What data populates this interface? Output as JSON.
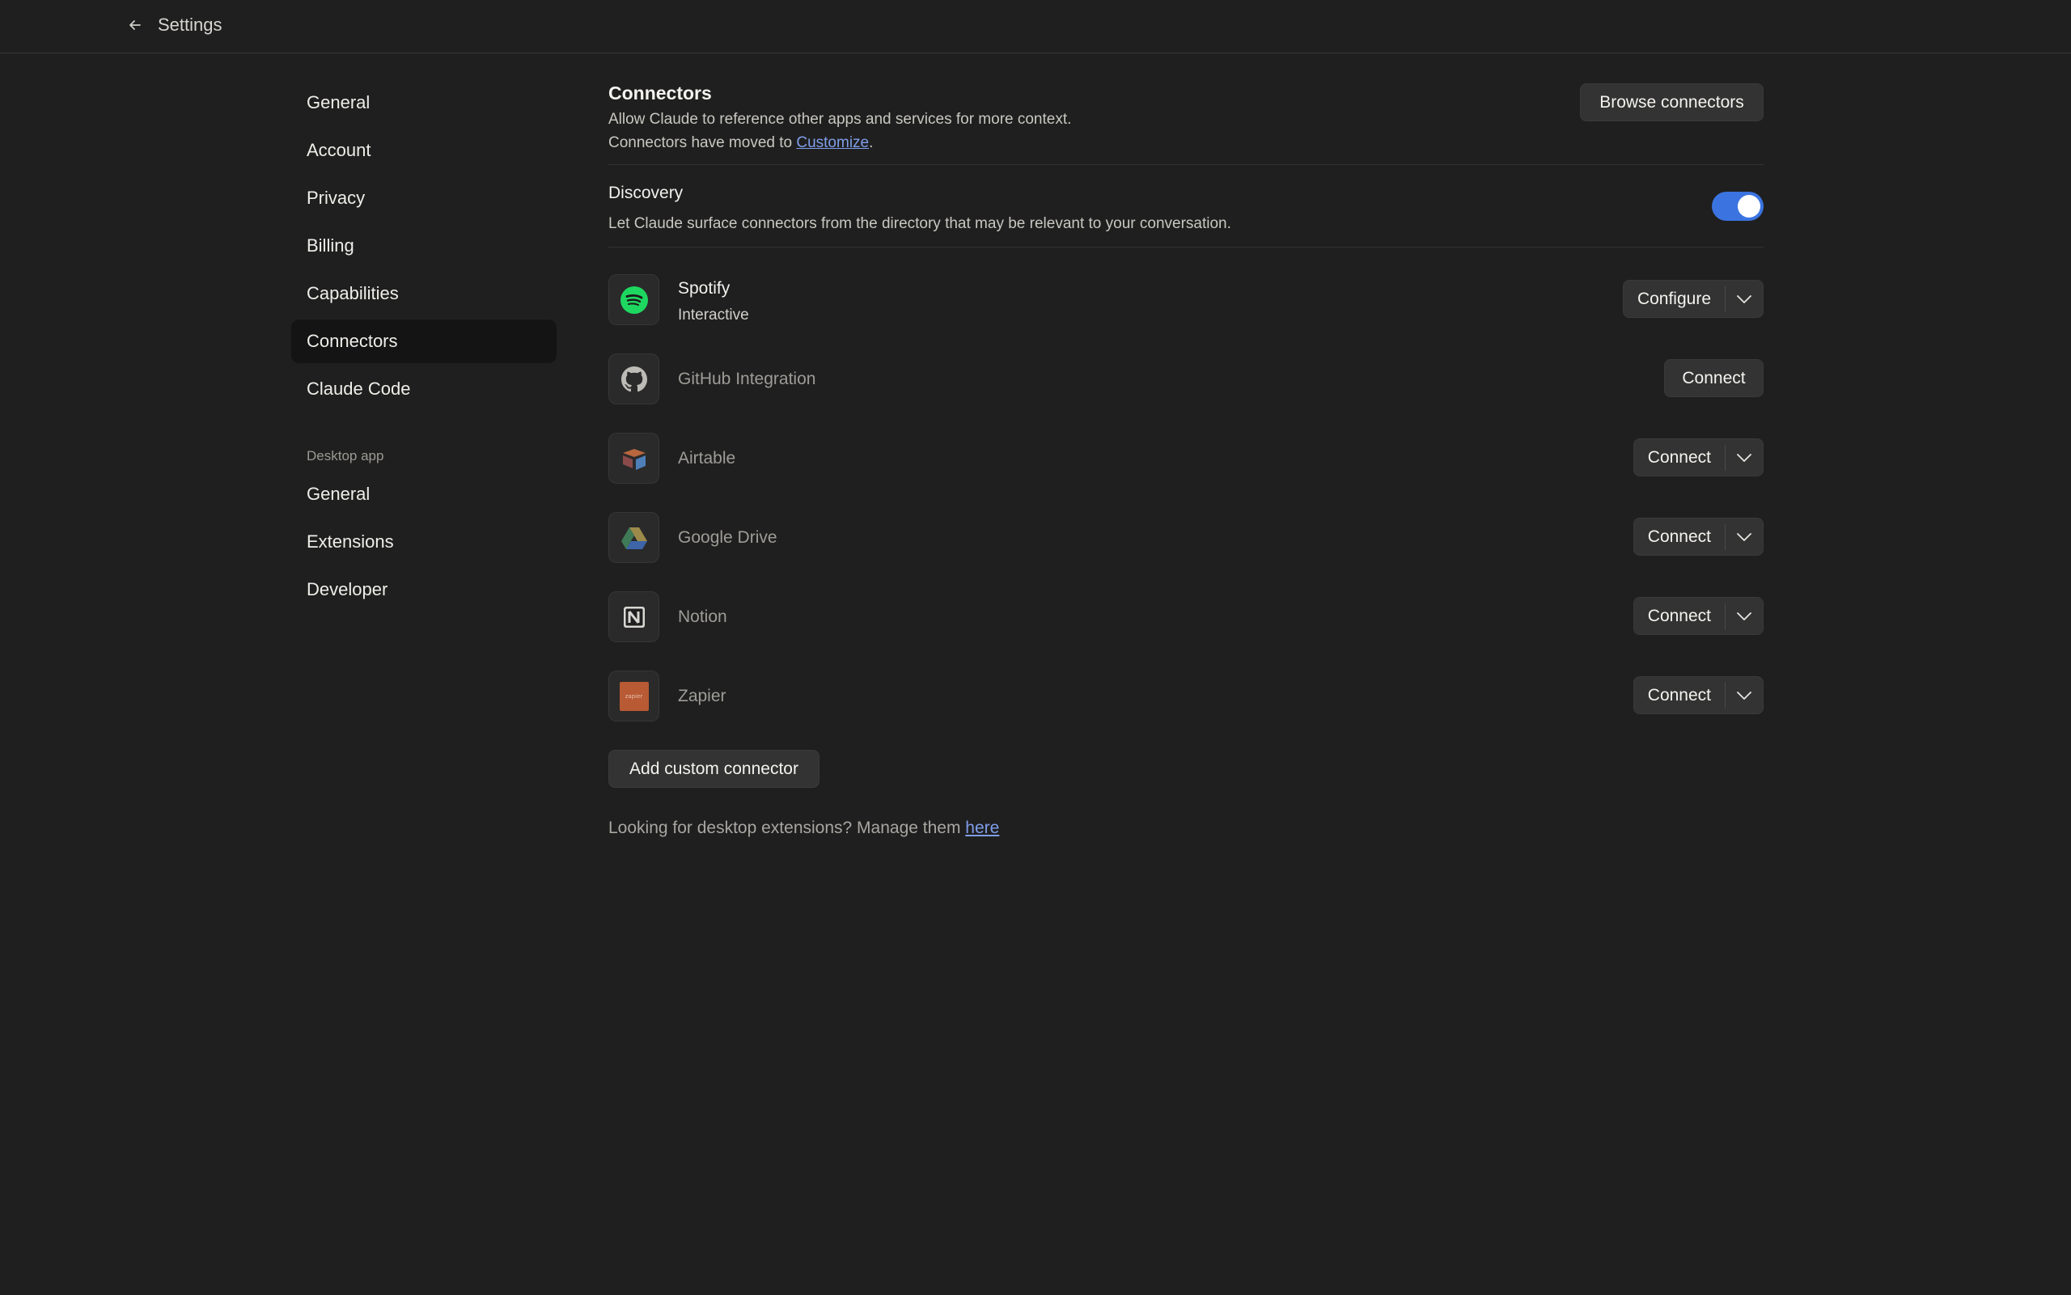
{
  "topbar": {
    "title": "Settings"
  },
  "sidebar": {
    "items": [
      {
        "label": "General"
      },
      {
        "label": "Account"
      },
      {
        "label": "Privacy"
      },
      {
        "label": "Billing"
      },
      {
        "label": "Capabilities"
      },
      {
        "label": "Connectors"
      },
      {
        "label": "Claude Code"
      }
    ],
    "section_label": "Desktop app",
    "desktop_items": [
      {
        "label": "General"
      },
      {
        "label": "Extensions"
      },
      {
        "label": "Developer"
      }
    ]
  },
  "header": {
    "title": "Connectors",
    "description": "Allow Claude to reference other apps and services for more context.",
    "moved_prefix": "Connectors have moved to ",
    "moved_link": "Customize",
    "moved_suffix": ".",
    "browse_label": "Browse connectors"
  },
  "discovery": {
    "title": "Discovery",
    "description": "Let Claude surface connectors from the directory that may be relevant to your conversation.",
    "enabled": true
  },
  "connectors": [
    {
      "name": "Spotify",
      "subtitle": "Interactive",
      "action": "Configure",
      "icon": "spotify-icon"
    },
    {
      "name": "GitHub Integration",
      "action": "Connect",
      "icon": "github-icon"
    },
    {
      "name": "Airtable",
      "action": "Connect",
      "icon": "airtable-icon"
    },
    {
      "name": "Google Drive",
      "action": "Connect",
      "icon": "google-drive-icon"
    },
    {
      "name": "Notion",
      "action": "Connect",
      "icon": "notion-icon"
    },
    {
      "name": "Zapier",
      "action": "Connect",
      "icon": "zapier-icon",
      "icon_text": "zapier"
    }
  ],
  "add_custom_label": "Add custom connector",
  "footer": {
    "prefix": "Looking for desktop extensions? Manage them ",
    "link": "here"
  },
  "colors": {
    "accent": "#3b74e0",
    "link": "#7f9eea",
    "spotify": "#1ed760",
    "zapier": "#e8592b"
  }
}
